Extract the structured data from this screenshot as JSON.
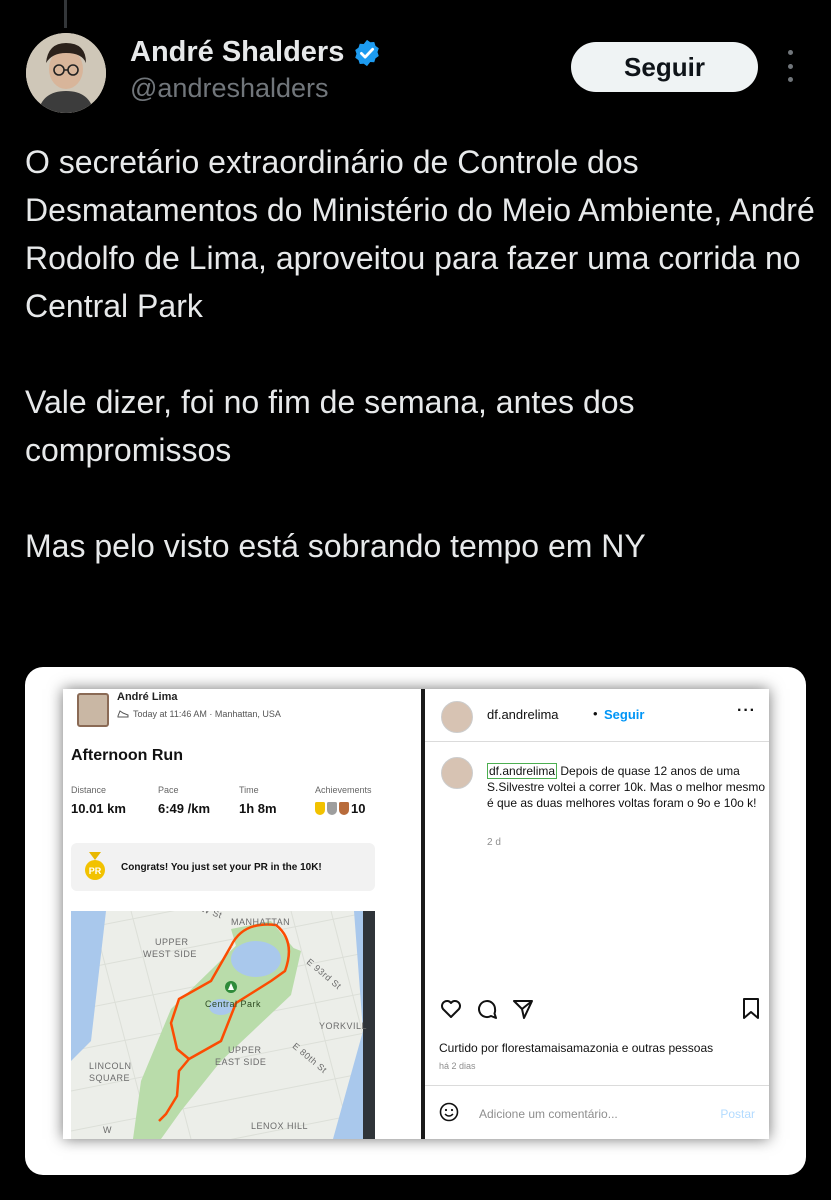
{
  "tweet": {
    "author": {
      "display_name": "André Shalders",
      "handle": "@andreshalders",
      "verified": true
    },
    "follow_label": "Seguir",
    "paragraphs": [
      "O secretário extraordinário de Controle dos Desmatamentos do Ministério do Meio Ambiente, André Rodolfo de Lima, aproveitou para fazer uma corrida no Central Park",
      "Vale dizer, foi no fim de semana, antes dos compromissos",
      "Mas pelo visto está sobrando tempo em NY"
    ]
  },
  "strava": {
    "athlete": "André Lima",
    "subtitle": "Today at 11:46 AM · Manhattan, USA",
    "activity_title": "Afternoon Run",
    "stats": {
      "distance_label": "Distance",
      "distance": "10.01 km",
      "pace_label": "Pace",
      "pace": "6:49 /km",
      "time_label": "Time",
      "time": "1h 8m",
      "achievements_label": "Achievements",
      "achievements": "10"
    },
    "pr_badge": "PR",
    "pr_message": "Congrats! You just set your PR in the 10K!",
    "map_labels": {
      "manhattan": "MANHATTAN",
      "upper_west_side_1": "UPPER",
      "upper_west_side_2": "WEST SIDE",
      "central_park": "Central Park",
      "yorkville": "YORKVILL",
      "upper_east_1": "UPPER",
      "upper_east_2": "EAST SIDE",
      "lincoln_1": "LINCOLN",
      "lincoln_2": "SQUARE",
      "lenox": "LENOX HILL",
      "e93": "E 93rd St",
      "e80": "E 80th St",
      "w_st": "W St",
      "w": "W"
    }
  },
  "instagram": {
    "username": "df.andrelima",
    "dot": "•",
    "follow": "Seguir",
    "caption_user": "df.andrelima",
    "caption_text": " Depois de quase 12 anos de uma S.Silvestre voltei a correr 10k. Mas o melhor mesmo é que as duas melhores voltas foram o 9o e 10o k!",
    "time": "2 d",
    "liked_by": "Curtido por florestamaisamazonia e outras pessoas",
    "ago": "há 2 dias",
    "comment_placeholder": "Adicione um comentário...",
    "post_label": "Postar"
  },
  "icons": [
    "verified-badge-icon",
    "more-options-icon",
    "shoe-icon",
    "medal-icon",
    "heart-icon",
    "comment-icon",
    "share-icon",
    "bookmark-icon",
    "emoji-icon"
  ],
  "colors": {
    "background": "#000000",
    "text": "#e7e9ea",
    "muted": "#71767b",
    "verified": "#1d9bf0",
    "strava_orange": "#fc4c02",
    "insta_blue": "#0095f6"
  }
}
